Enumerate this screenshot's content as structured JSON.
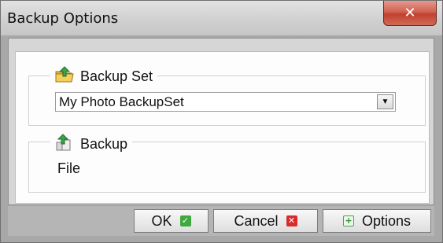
{
  "window": {
    "title": "Backup Options",
    "close_icon": "close-x-icon"
  },
  "backup_set": {
    "legend": "Backup Set",
    "icon": "folder-up-arrow-icon",
    "selected": "My Photo BackupSet",
    "dropdown_icon": "dropdown-arrow-icon"
  },
  "backup": {
    "legend": "Backup",
    "icon": "backup-files-icon",
    "value": "File"
  },
  "buttons": {
    "ok": {
      "label": "OK",
      "icon": "green-check-icon"
    },
    "cancel": {
      "label": "Cancel",
      "icon": "red-x-icon"
    },
    "options": {
      "label": "Options",
      "icon": "plus-icon"
    }
  }
}
